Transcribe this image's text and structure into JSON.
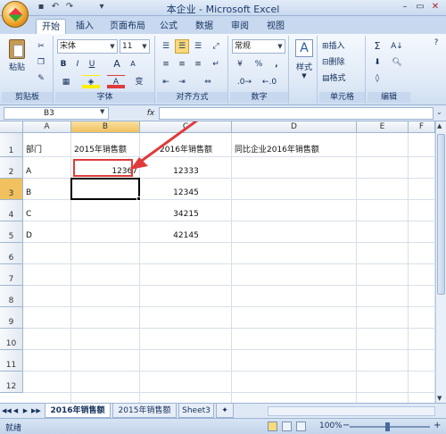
{
  "window": {
    "title": "本企业 - Microsoft Excel",
    "min_glyph": "–",
    "max_glyph": "▭",
    "close_glyph": "✕"
  },
  "quick_access": {
    "save_glyph": "▪",
    "undo_glyph": "↶",
    "redo_glyph": "↷",
    "customize_glyph": "▾"
  },
  "tabs": [
    "开始",
    "插入",
    "页面布局",
    "公式",
    "数据",
    "审阅",
    "视图"
  ],
  "ribbon": {
    "clipboard": {
      "label": "剪贴板",
      "paste_label": "粘贴"
    },
    "font": {
      "label": "字体",
      "font_name": "宋体",
      "font_size": "11",
      "bold": "B",
      "italic": "I",
      "underline": "U",
      "grow": "A",
      "shrink": "A",
      "font_color_glyph": "A",
      "phonetic_glyph": "变"
    },
    "alignment": {
      "label": "对齐方式"
    },
    "number": {
      "label": "数字",
      "format": "常规",
      "currency_glyph": "¥",
      "percent_glyph": "%",
      "comma_glyph": ","
    },
    "styles": {
      "label": "样式",
      "big_icon": "A"
    },
    "cells": {
      "label": "单元格",
      "insert": "插入",
      "delete": "删除",
      "format": "格式"
    },
    "editing": {
      "label": "编辑",
      "sum_glyph": "Σ",
      "sort_glyph": "A↓"
    }
  },
  "formula_bar": {
    "name_box": "B3",
    "fx_label": "fx",
    "value": ""
  },
  "grid": {
    "columns": [
      "A",
      "B",
      "C",
      "D",
      "E",
      "F"
    ],
    "rows": [
      "1",
      "2",
      "3",
      "4",
      "5",
      "6",
      "7",
      "8",
      "9",
      "10",
      "11",
      "12"
    ],
    "selected_column": "B",
    "selected_row": "3",
    "cells": {
      "A1": "部门",
      "B1": "2015年销售额",
      "C1": "2016年销售额",
      "D1": "同比企业2016年销售额",
      "A2": "A",
      "B2": "12367",
      "C2": "12333",
      "A3": "B",
      "C3": "12345",
      "A4": "C",
      "C4": "34215",
      "A5": "D",
      "C5": "42145"
    }
  },
  "sheet_tabs": [
    "2016年销售额",
    "2015年销售额",
    "Sheet3"
  ],
  "nav_glyphs": [
    "◀◀",
    "◀",
    "▶",
    "▶▶"
  ],
  "status": {
    "text": "就绪",
    "zoom": "100%",
    "zoom_minus": "−",
    "zoom_plus": "+"
  },
  "colors": {
    "accent": "#e03b3b",
    "ribbon_bg": "#dfe9f6",
    "header_select": "#f1c15f"
  }
}
